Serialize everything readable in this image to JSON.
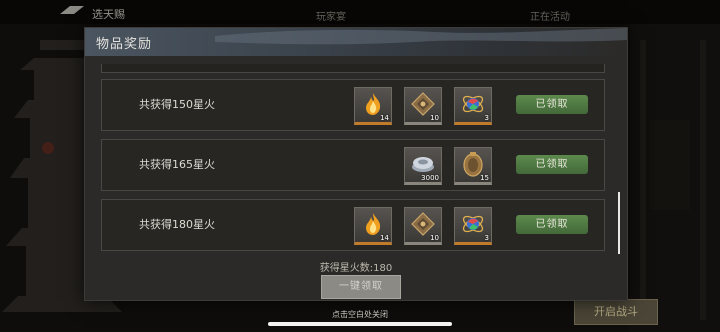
{
  "background": {
    "title": "选天赐",
    "tabs": [
      "玩家宴",
      "正在活动"
    ],
    "right_button": "开启战斗"
  },
  "dialog": {
    "title": "物品奖励",
    "rows": [
      {
        "label": "共获得150星火",
        "items": [
          {
            "icon": "flame-icon",
            "qty": "14"
          },
          {
            "icon": "bronze-token-icon",
            "qty": "10"
          },
          {
            "icon": "rainbow-orb-icon",
            "qty": "3"
          }
        ],
        "status": "已领取"
      },
      {
        "label": "共获得165星火",
        "items": [
          {
            "icon": "silver-ingot-icon",
            "qty": "3000"
          },
          {
            "icon": "bronze-medal-icon",
            "qty": "15"
          }
        ],
        "status": "已领取"
      },
      {
        "label": "共获得180星火",
        "items": [
          {
            "icon": "flame-icon",
            "qty": "14"
          },
          {
            "icon": "bronze-token-icon",
            "qty": "10"
          },
          {
            "icon": "rainbow-orb-icon",
            "qty": "3"
          }
        ],
        "status": "已领取"
      }
    ],
    "count_text": "获得星火数:180",
    "claim_all": "一键领取"
  },
  "close_hint": "点击空白处关闭",
  "colors": {
    "claimed_green": "#4f7c42",
    "panel": "#2b2a28",
    "header_blue": "#4b5560"
  }
}
